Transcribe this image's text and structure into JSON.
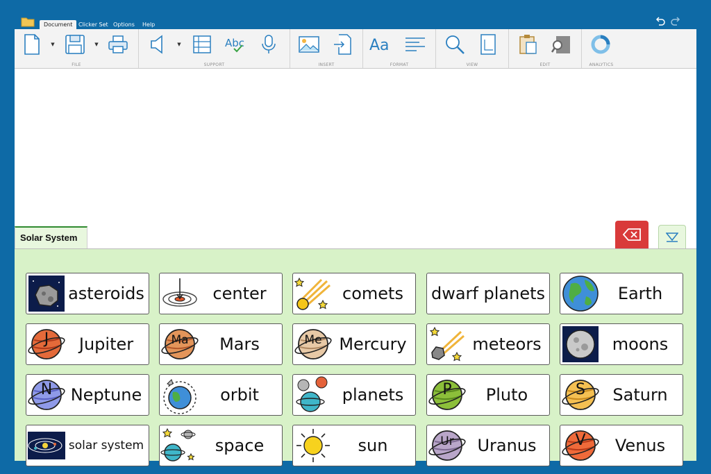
{
  "menubar": {
    "tabs": [
      "Document",
      "Clicker Set",
      "Options",
      "Help"
    ],
    "active_tab": "Document"
  },
  "ribbon": {
    "groups": [
      "FILE",
      "SUPPORT",
      "INSERT",
      "FORMAT",
      "VIEW",
      "EDIT",
      "ANALYTICS"
    ],
    "icons": {
      "new": "new-document-icon",
      "save": "save-icon",
      "print": "print-icon",
      "speaker": "speaker-icon",
      "word_list": "numbered-list-icon",
      "spellcheck": "spellcheck-icon",
      "microphone": "microphone-icon",
      "picture": "insert-picture-icon",
      "insert_file": "insert-file-icon",
      "font": "font-icon",
      "align": "align-text-icon",
      "zoom": "zoom-icon",
      "page": "page-icon",
      "paste": "paste-icon",
      "find": "find-replace-icon",
      "analytics": "analytics-chart-icon"
    },
    "font_glyph": "Aa",
    "spell_glyph": "Abc"
  },
  "panel": {
    "tab_label": "Solar System",
    "accent": "#2f8a2f",
    "background": "#d8f2c8",
    "delete_color": "#d93a3a"
  },
  "cells": [
    {
      "label": "asteroids",
      "icon": "asteroid-icon"
    },
    {
      "label": "center",
      "icon": "target-center-icon"
    },
    {
      "label": "comets",
      "icon": "comet-icon"
    },
    {
      "label": "dwarf planets",
      "icon": ""
    },
    {
      "label": "Earth",
      "icon": "earth-icon"
    },
    {
      "label": "Jupiter",
      "icon": "jupiter-icon",
      "letter": "J"
    },
    {
      "label": "Mars",
      "icon": "mars-icon",
      "letter": "Ma"
    },
    {
      "label": "Mercury",
      "icon": "mercury-icon",
      "letter": "Me"
    },
    {
      "label": "meteors",
      "icon": "meteor-icon"
    },
    {
      "label": "moons",
      "icon": "moon-icon"
    },
    {
      "label": "Neptune",
      "icon": "neptune-icon",
      "letter": "N"
    },
    {
      "label": "orbit",
      "icon": "orbit-icon"
    },
    {
      "label": "planets",
      "icon": "planets-icon"
    },
    {
      "label": "Pluto",
      "icon": "pluto-icon",
      "letter": "P"
    },
    {
      "label": "Saturn",
      "icon": "saturn-icon",
      "letter": "S"
    },
    {
      "label": "solar system",
      "icon": "solar-system-icon"
    },
    {
      "label": "space",
      "icon": "space-icon"
    },
    {
      "label": "sun",
      "icon": "sun-icon"
    },
    {
      "label": "Uranus",
      "icon": "uranus-icon",
      "letter": "Ur"
    },
    {
      "label": "Venus",
      "icon": "venus-icon",
      "letter": "V"
    }
  ]
}
